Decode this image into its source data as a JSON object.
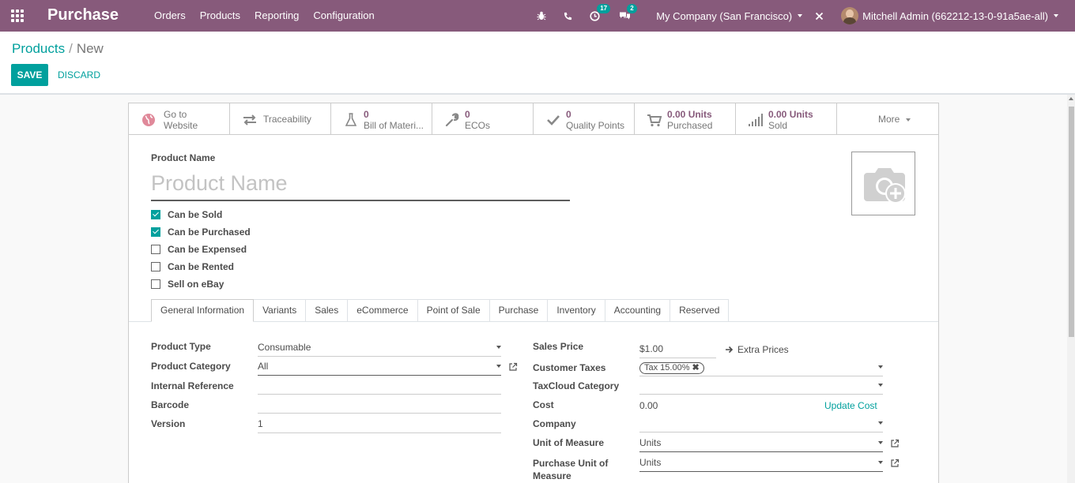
{
  "navbar": {
    "app_name": "Purchase",
    "menu": [
      "Orders",
      "Products",
      "Reporting",
      "Configuration"
    ],
    "activity_count": "17",
    "message_count": "2",
    "company": "My Company (San Francisco)",
    "user": "Mitchell Admin (662212-13-0-91a5ae-all)"
  },
  "breadcrumb": {
    "parent": "Products",
    "separator": "/",
    "current": "New"
  },
  "buttons": {
    "save": "SAVE",
    "discard": "DISCARD"
  },
  "smart_buttons": {
    "website": {
      "line1": "Go to",
      "line2": "Website"
    },
    "traceability": {
      "label": "Traceability"
    },
    "bom": {
      "count": "0",
      "label": "Bill of Materi..."
    },
    "ecos": {
      "count": "0",
      "label": "ECOs"
    },
    "quality": {
      "count": "0",
      "label": "Quality Points"
    },
    "purchased": {
      "count": "0.00 Units",
      "label": "Purchased"
    },
    "sold": {
      "count": "0.00 Units",
      "label": "Sold"
    },
    "more": {
      "label": "More"
    }
  },
  "product": {
    "name_label": "Product Name",
    "name_placeholder": "Product Name",
    "options": [
      {
        "label": "Can be Sold",
        "checked": true
      },
      {
        "label": "Can be Purchased",
        "checked": true
      },
      {
        "label": "Can be Expensed",
        "checked": false
      },
      {
        "label": "Can be Rented",
        "checked": false
      },
      {
        "label": "Sell on eBay",
        "checked": false
      }
    ]
  },
  "tabs": [
    "General Information",
    "Variants",
    "Sales",
    "eCommerce",
    "Point of Sale",
    "Purchase",
    "Inventory",
    "Accounting",
    "Reserved"
  ],
  "left_fields": {
    "product_type": {
      "label": "Product Type",
      "value": "Consumable"
    },
    "product_category": {
      "label": "Product Category",
      "value": "All"
    },
    "internal_reference": {
      "label": "Internal Reference",
      "value": ""
    },
    "barcode": {
      "label": "Barcode",
      "value": ""
    },
    "version": {
      "label": "Version",
      "value": "1"
    }
  },
  "right_fields": {
    "sales_price": {
      "label": "Sales Price",
      "value": "$1.00",
      "extra": "Extra Prices"
    },
    "customer_taxes": {
      "label": "Customer Taxes",
      "tag": "Tax 15.00%",
      "tag_remove": "✖"
    },
    "taxcloud_category": {
      "label": "TaxCloud Category",
      "value": ""
    },
    "cost": {
      "label": "Cost",
      "value": "0.00",
      "action": "Update Cost"
    },
    "company": {
      "label": "Company",
      "value": ""
    },
    "uom": {
      "label": "Unit of Measure",
      "value": "Units"
    },
    "purchase_uom": {
      "label_line1": "Purchase Unit of",
      "label_line2": "Measure",
      "value": "Units"
    }
  },
  "colors": {
    "brand": "#875a7b",
    "accent": "#00a09d"
  }
}
